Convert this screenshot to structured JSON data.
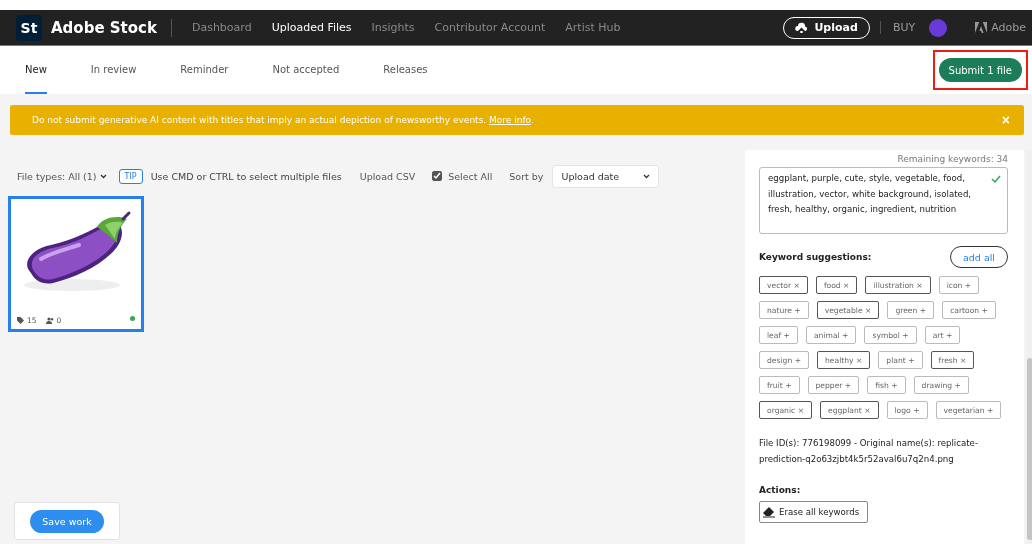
{
  "header": {
    "logo_mark": "St",
    "brand": "Adobe Stock",
    "nav": [
      {
        "label": "Dashboard",
        "selected": false
      },
      {
        "label": "Uploaded Files",
        "selected": true
      },
      {
        "label": "Insights",
        "selected": false
      },
      {
        "label": "Contributor Account",
        "selected": false
      },
      {
        "label": "Artist Hub",
        "selected": false
      }
    ],
    "upload_button": "Upload",
    "buy": "BUY",
    "adobe": "Adobe"
  },
  "tabs": [
    {
      "label": "New",
      "selected": true
    },
    {
      "label": "In review",
      "selected": false
    },
    {
      "label": "Reminder",
      "selected": false
    },
    {
      "label": "Not accepted",
      "selected": false
    },
    {
      "label": "Releases",
      "selected": false
    }
  ],
  "submit_button": {
    "label": "Submit 1 file",
    "highlighted": true
  },
  "banner": {
    "text": "Do not submit generative AI content with titles that imply an actual depiction of newsworthy events.",
    "link": "More info",
    "after": ".",
    "close": "×"
  },
  "toolbar": {
    "file_types": "File types: All (1)",
    "tip_badge": "TIP",
    "tip": "Use CMD or CTRL to select multiple files",
    "upload_csv": "Upload CSV",
    "select_all": {
      "label": "Select All",
      "checked": true
    },
    "sort_label": "Sort by",
    "sort_value": "Upload date"
  },
  "files": [
    {
      "kind": "picture",
      "keywords_count": "15",
      "releases_count": "0",
      "selected": true
    }
  ],
  "panel": {
    "remaining": "Remaining keywords: 34",
    "keywords": "eggplant, purple, cute, style, vegetable, food, illustration, vector, white background, isolated, fresh, healthy, organic, ingredient, nutrition",
    "suggestions_title": "Keyword suggestions:",
    "add_all": "add all",
    "suggestions": [
      [
        {
          "label": "vector",
          "selected": true
        },
        {
          "label": "food",
          "selected": true
        },
        {
          "label": "illustration",
          "selected": true
        },
        {
          "label": "icon",
          "selected": false
        }
      ],
      [
        {
          "label": "nature",
          "selected": false
        },
        {
          "label": "vegetable",
          "selected": true
        },
        {
          "label": "green",
          "selected": false
        },
        {
          "label": "cartoon",
          "selected": false
        }
      ],
      [
        {
          "label": "leaf",
          "selected": false
        },
        {
          "label": "animal",
          "selected": false
        },
        {
          "label": "symbol",
          "selected": false
        },
        {
          "label": "art",
          "selected": false
        }
      ],
      [
        {
          "label": "design",
          "selected": false
        },
        {
          "label": "healthy",
          "selected": true
        },
        {
          "label": "plant",
          "selected": false
        },
        {
          "label": "fresh",
          "selected": true
        }
      ],
      [
        {
          "label": "fruit",
          "selected": false
        },
        {
          "label": "pepper",
          "selected": false
        },
        {
          "label": "fish",
          "selected": false
        },
        {
          "label": "drawing",
          "selected": false
        }
      ],
      [
        {
          "label": "organic",
          "selected": true
        },
        {
          "label": "eggplant",
          "selected": true
        },
        {
          "label": "logo",
          "selected": false
        },
        {
          "label": "vegetarian",
          "selected": false
        }
      ]
    ],
    "remove_mark": "×",
    "add_mark": "+",
    "file_info": "File ID(s): 776198099 - Original name(s): replicate-prediction-q2o63zjbt4k5r52aval6u7q2n4.png",
    "actions_title": "Actions:",
    "erase_button": "Erase all keywords"
  },
  "save_button": "Save work"
}
